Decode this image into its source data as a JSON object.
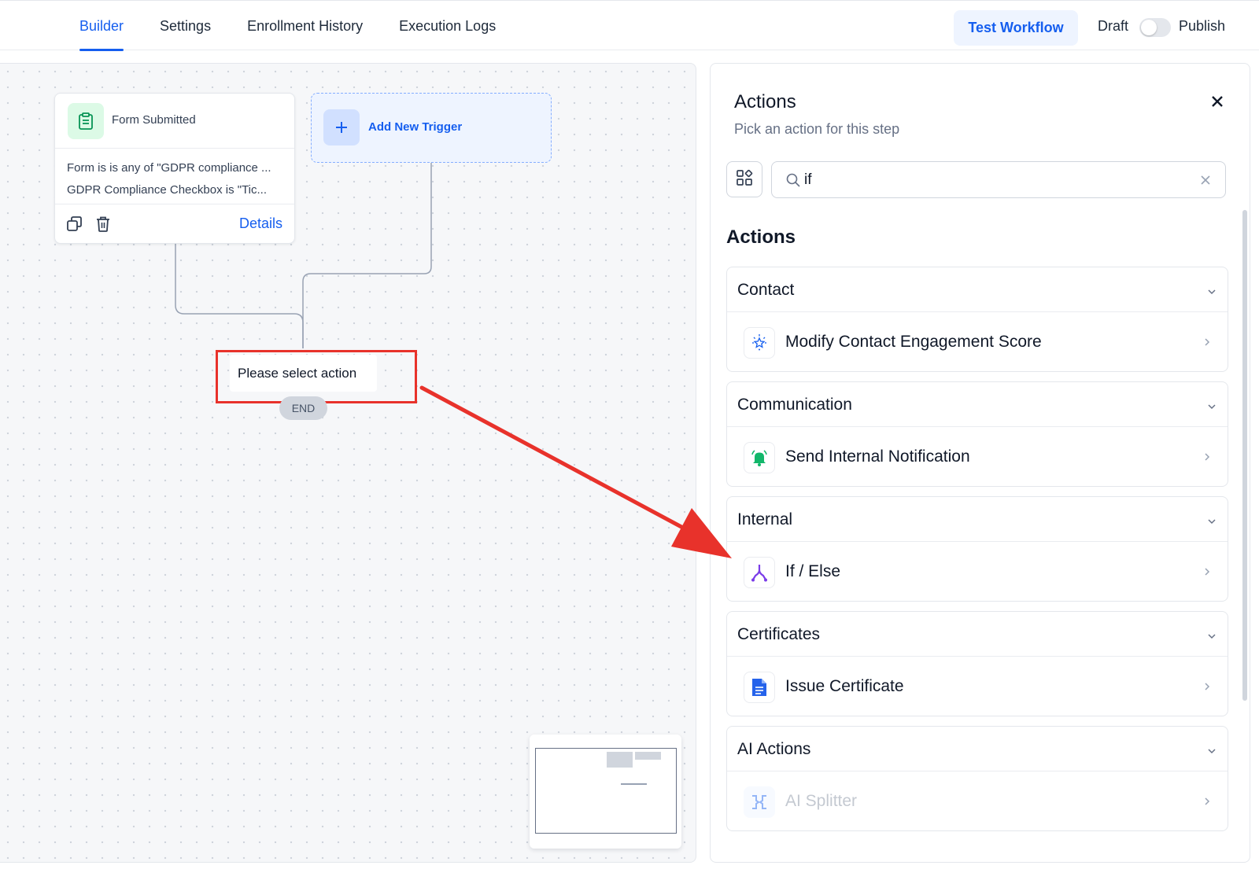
{
  "nav": {
    "tabs": [
      {
        "label": "Builder",
        "active": true
      },
      {
        "label": "Settings",
        "active": false
      },
      {
        "label": "Enrollment History",
        "active": false
      },
      {
        "label": "Execution Logs",
        "active": false
      }
    ],
    "test_workflow": "Test Workflow",
    "draft": "Draft",
    "publish": "Publish",
    "publish_toggle_on": false
  },
  "canvas": {
    "trigger": {
      "title": "Form Submitted",
      "conditions": [
        "Form is is any of \"GDPR compliance ...",
        "GDPR Compliance Checkbox is \"Tic..."
      ],
      "details": "Details"
    },
    "add_trigger": "Add New Trigger",
    "select_action": "Please select action",
    "end": "END"
  },
  "panel": {
    "title": "Actions",
    "subtitle": "Pick an action for this step",
    "search": {
      "value": "if"
    },
    "section_heading": "Actions",
    "groups": [
      {
        "title": "Contact",
        "items": [
          {
            "label": "Modify Contact Engagement Score",
            "icon": "engagement-score-icon"
          }
        ]
      },
      {
        "title": "Communication",
        "items": [
          {
            "label": "Send Internal Notification",
            "icon": "bell-icon"
          }
        ]
      },
      {
        "title": "Internal",
        "items": [
          {
            "label": "If / Else",
            "icon": "branch-icon"
          }
        ]
      },
      {
        "title": "Certificates",
        "items": [
          {
            "label": "Issue Certificate",
            "icon": "document-icon"
          }
        ]
      },
      {
        "title": "AI Actions",
        "items": [
          {
            "label": "AI Splitter",
            "icon": "ai-splitter-icon"
          }
        ]
      }
    ]
  },
  "colors": {
    "accent": "#155eef",
    "annotation_red": "#e8322b",
    "trigger_icon_bg": "#dcfae6",
    "bell_green": "#12b76a",
    "branch_purple": "#7a3ce8",
    "doc_blue": "#2563eb"
  }
}
